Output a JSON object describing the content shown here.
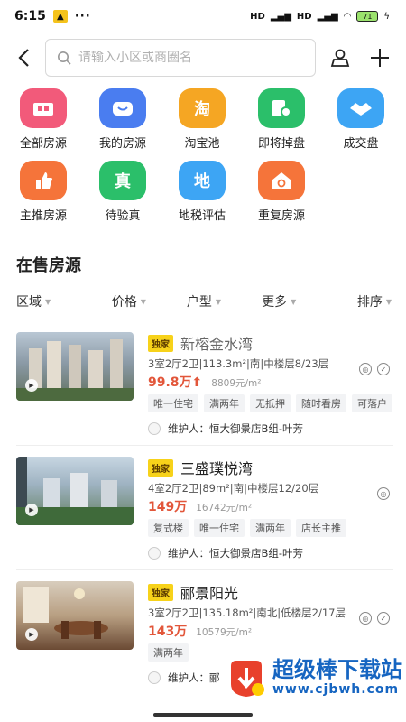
{
  "status_bar": {
    "time": "6:15",
    "dots": "···",
    "signal_1": "HD",
    "signal_2": "HD",
    "battery": "71"
  },
  "search": {
    "placeholder": "请输入小区或商圈名"
  },
  "quick_menu": [
    {
      "label": "全部房源",
      "icon": "all-listings-icon",
      "color": "#f25a7a"
    },
    {
      "label": "我的房源",
      "icon": "my-listings-icon",
      "color": "#4a7df0"
    },
    {
      "label": "淘宝池",
      "icon": "tao-pool-icon",
      "glyph": "淘",
      "color": "#f5a623"
    },
    {
      "label": "即将掉盘",
      "icon": "about-to-drop-icon",
      "color": "#2bbf6a"
    },
    {
      "label": "成交盘",
      "icon": "deal-icon",
      "color": "#3da5f4"
    },
    {
      "label": "主推房源",
      "icon": "promoted-icon",
      "color": "#f5743a"
    },
    {
      "label": "待验真",
      "icon": "to-verify-icon",
      "glyph": "真",
      "color": "#2bbf6a"
    },
    {
      "label": "地税评估",
      "icon": "tax-assess-icon",
      "glyph": "地",
      "color": "#3da5f4"
    },
    {
      "label": "重复房源",
      "icon": "duplicate-icon",
      "color": "#f5743a"
    }
  ],
  "section_title": "在售房源",
  "filters": [
    "区域",
    "价格",
    "户型",
    "更多",
    "排序"
  ],
  "listings": [
    {
      "badge": "独家",
      "name": "新榕金水湾",
      "spec": "3室2厅2卫|113.3m²|南|中楼层8/23层",
      "price": "99.8万",
      "price_trend": "⬆",
      "unit_price": "8809元/m²",
      "tags": [
        "唯一住宅",
        "满两年",
        "无抵押",
        "随时看房",
        "可落户"
      ],
      "agent": "维护人：恒大御景店B组-叶芳",
      "thumb_color": "#7b8a96"
    },
    {
      "badge": "独家",
      "name": "三盛璞悦湾",
      "spec": "4室2厅2卫|89m²|南|中楼层12/20层",
      "price": "149万",
      "price_trend": "",
      "unit_price": "16742元/m²",
      "tags": [
        "复式楼",
        "唯一住宅",
        "满两年",
        "店长主推"
      ],
      "agent": "维护人：恒大御景店B组-叶芳",
      "thumb_color": "#5e7f6d"
    },
    {
      "badge": "独家",
      "name": "郦景阳光",
      "spec": "3室2厅2卫|135.18m²|南北|低楼层2/17层",
      "price": "143万",
      "price_trend": "",
      "unit_price": "10579元/m²",
      "tags": [
        "满两年"
      ],
      "agent": "维护人：郦",
      "thumb_color": "#8a6f58"
    }
  ],
  "watermark": {
    "cn": "超级棒下载站",
    "url": "www.cjbwh.com"
  }
}
